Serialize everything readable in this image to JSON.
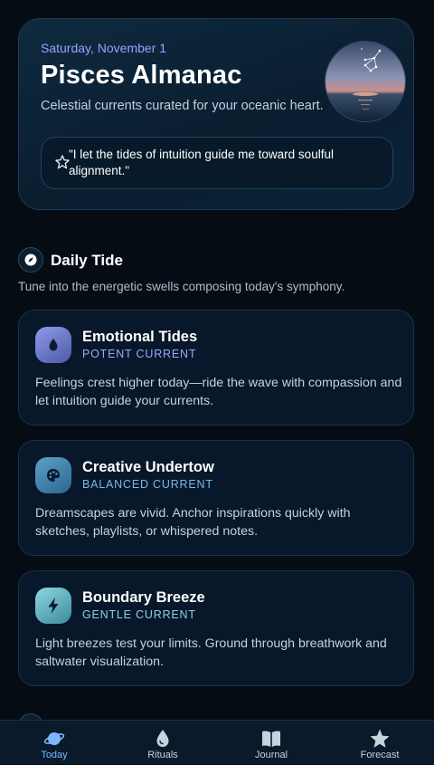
{
  "hero": {
    "date": "Saturday, November 1",
    "title": "Pisces Almanac",
    "subtitle": "Celestial currents curated for your oceanic heart.",
    "quote": "\"I let the tides of intuition guide me toward soulful alignment.\""
  },
  "section": {
    "title": "Daily Tide",
    "subtitle": "Tune into the energetic swells composing today's symphony.",
    "icon": "compass-icon"
  },
  "cards": [
    {
      "title": "Emotional Tides",
      "tag": "POTENT CURRENT",
      "body": "Feelings crest higher today—ride the wave with compassion and let intuition guide your currents.",
      "icon": "water-drop-icon",
      "tag_color": "#9aa8ff"
    },
    {
      "title": "Creative Undertow",
      "tag": "BALANCED CURRENT",
      "body": "Dreamscapes are vivid. Anchor inspirations quickly with sketches, playlists, or whispered notes.",
      "icon": "palette-icon",
      "tag_color": "#7ab8e8"
    },
    {
      "title": "Boundary Breeze",
      "tag": "GENTLE CURRENT",
      "body": "Light breezes test your limits. Ground through breathwork and saltwater visualization.",
      "icon": "lightning-icon",
      "tag_color": "#8fd0e0"
    }
  ],
  "nav": [
    {
      "label": "Today",
      "icon": "planet-icon",
      "active": true
    },
    {
      "label": "Rituals",
      "icon": "water-drop-icon",
      "active": false
    },
    {
      "label": "Journal",
      "icon": "book-icon",
      "active": false
    },
    {
      "label": "Forecast",
      "icon": "star-icon",
      "active": false
    }
  ],
  "colors": {
    "background": "#050c14",
    "accent": "#7ab8ff",
    "date_text": "#8fa6ff"
  }
}
